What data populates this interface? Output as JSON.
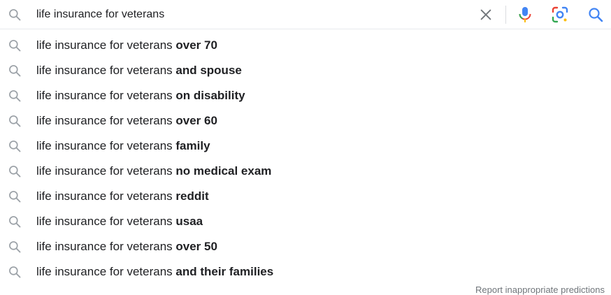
{
  "search": {
    "query": "life insurance for veterans"
  },
  "suggestions": [
    {
      "prefix": "life insurance for veterans ",
      "completion": "over 70"
    },
    {
      "prefix": "life insurance for veterans ",
      "completion": "and spouse"
    },
    {
      "prefix": "life insurance for veterans ",
      "completion": "on disability"
    },
    {
      "prefix": "life insurance for veterans ",
      "completion": "over 60"
    },
    {
      "prefix": "life insurance for veterans ",
      "completion": "family"
    },
    {
      "prefix": "life insurance for veterans ",
      "completion": "no medical exam"
    },
    {
      "prefix": "life insurance for veterans ",
      "completion": "reddit"
    },
    {
      "prefix": "life insurance for veterans ",
      "completion": "usaa"
    },
    {
      "prefix": "life insurance for veterans ",
      "completion": "over 50"
    },
    {
      "prefix": "life insurance for veterans ",
      "completion": "and their families"
    }
  ],
  "footer": {
    "report_link": "Report inappropriate predictions"
  },
  "icons": {
    "search": "search-icon",
    "clear": "close-icon",
    "mic": "microphone-icon",
    "lens": "google-lens-icon"
  },
  "colors": {
    "icon_gray": "#9aa0a6",
    "google_blue": "#4285f4",
    "google_red": "#ea4335",
    "google_yellow": "#fbbc04",
    "google_green": "#34a853"
  }
}
